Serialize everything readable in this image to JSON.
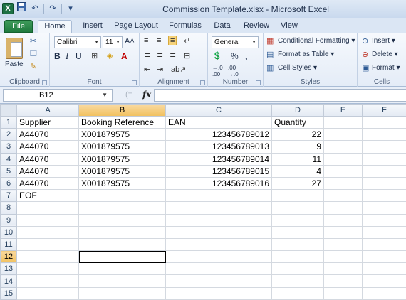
{
  "window": {
    "title": "Commission Template.xlsx - Microsoft Excel",
    "logo_letter": "X"
  },
  "qat": {
    "save_icon": "save-icon",
    "undo_glyph": "↶",
    "redo_glyph": "↷",
    "customize_glyph": "▾"
  },
  "tabs": [
    "File",
    "Home",
    "Insert",
    "Page Layout",
    "Formulas",
    "Data",
    "Review",
    "View"
  ],
  "ribbon": {
    "clipboard": {
      "label": "Clipboard",
      "paste": "Paste"
    },
    "font": {
      "label": "Font",
      "family": "Calibri",
      "size": "11",
      "grow": "A˄",
      "shrink": "A˅",
      "bold": "B",
      "italic": "I",
      "underline": "U"
    },
    "alignment": {
      "label": "Alignment"
    },
    "number": {
      "label": "Number",
      "format": "General",
      "percent": "%",
      "comma": ","
    },
    "styles": {
      "label": "Styles",
      "conditional": "Conditional Formatting ▾",
      "table": "Format as Table ▾",
      "cell_styles": "Cell Styles ▾"
    },
    "cells": {
      "label": "Cells",
      "insert": "Insert ▾",
      "delete": "Delete ▾",
      "format": "Format ▾"
    }
  },
  "formula_bar": {
    "name_box": "B12",
    "fx": "fx",
    "value": ""
  },
  "sheet": {
    "columns": [
      "A",
      "B",
      "C",
      "D",
      "E",
      "F"
    ],
    "selected_column": "B",
    "selected_row": 12,
    "rows": [
      {
        "n": "1",
        "a": "Supplier",
        "b": "Booking Reference",
        "c": "EAN",
        "d": "Quantity"
      },
      {
        "n": "2",
        "a": "A44070",
        "b": "X001879575",
        "c": "123456789012",
        "d": "22"
      },
      {
        "n": "3",
        "a": "A44070",
        "b": "X001879575",
        "c": "123456789013",
        "d": "9"
      },
      {
        "n": "4",
        "a": "A44070",
        "b": "X001879575",
        "c": "123456789014",
        "d": "11"
      },
      {
        "n": "5",
        "a": "A44070",
        "b": "X001879575",
        "c": "123456789015",
        "d": "4"
      },
      {
        "n": "6",
        "a": "A44070",
        "b": "X001879575",
        "c": "123456789016",
        "d": "27"
      },
      {
        "n": "7",
        "a": "EOF",
        "b": "",
        "c": "",
        "d": ""
      },
      {
        "n": "8",
        "a": "",
        "b": "",
        "c": "",
        "d": ""
      },
      {
        "n": "9",
        "a": "",
        "b": "",
        "c": "",
        "d": ""
      },
      {
        "n": "10",
        "a": "",
        "b": "",
        "c": "",
        "d": ""
      },
      {
        "n": "11",
        "a": "",
        "b": "",
        "c": "",
        "d": ""
      },
      {
        "n": "12",
        "a": "",
        "b": "",
        "c": "",
        "d": ""
      },
      {
        "n": "13",
        "a": "",
        "b": "",
        "c": "",
        "d": ""
      },
      {
        "n": "14",
        "a": "",
        "b": "",
        "c": "",
        "d": ""
      },
      {
        "n": "15",
        "a": "",
        "b": "",
        "c": "",
        "d": ""
      }
    ]
  }
}
